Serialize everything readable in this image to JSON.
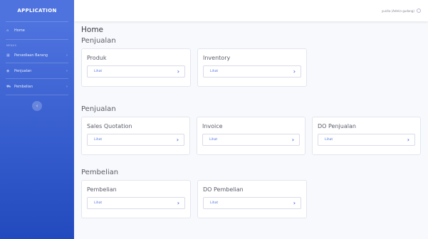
{
  "sidebar": {
    "brand": "APPLICATION",
    "home": {
      "label": "Home",
      "icon": "home-icon"
    },
    "menu_heading": "MENUS",
    "items": [
      {
        "label": "Persediaan Barang",
        "icon": "box-icon"
      },
      {
        "label": "Penjualan",
        "icon": "eye-icon"
      },
      {
        "label": "Pembelian",
        "icon": "cart-icon"
      }
    ],
    "toggle_glyph": "‹"
  },
  "topbar": {
    "user": "yunita (Admin gudang)"
  },
  "page": {
    "title": "Home",
    "groups": [
      {
        "title": "Penjualan",
        "cards": [
          {
            "title": "Produk",
            "link": "Lihat"
          },
          {
            "title": "Inventory",
            "link": "Lihat"
          }
        ]
      },
      {
        "title": "Penjualan",
        "cards": [
          {
            "title": "Sales Quotation",
            "link": "Lihat"
          },
          {
            "title": "Invoice",
            "link": "Lihat"
          },
          {
            "title": "DO Penjualan",
            "link": "Lihat"
          }
        ]
      },
      {
        "title": "Pembelian",
        "cards": [
          {
            "title": "Pembelian",
            "link": "Lihat"
          },
          {
            "title": "DO Pembelian",
            "link": "Lihat"
          }
        ]
      }
    ]
  },
  "colors": {
    "primary": "#4e73df",
    "primary_dark": "#224abe"
  }
}
